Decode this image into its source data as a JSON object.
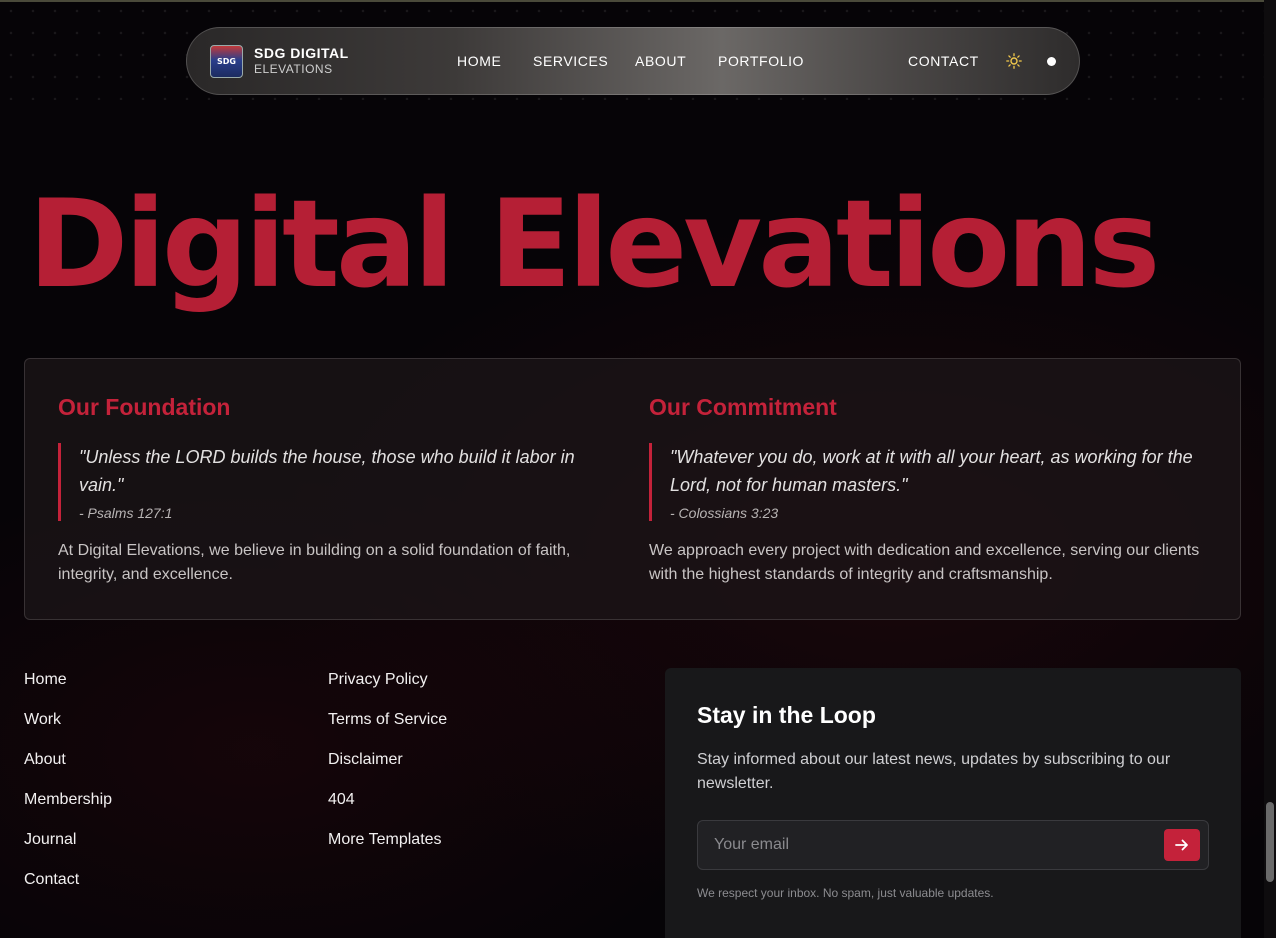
{
  "nav": {
    "brand_name": "SDG DIGITAL",
    "brand_sub": "ELEVATIONS",
    "logo_text": "SDG",
    "links": [
      "HOME",
      "SERVICES",
      "ABOUT",
      "PORTFOLIO",
      "CONTACT"
    ],
    "theme_icon": "sun-icon"
  },
  "hero": {
    "title": "Digital Elevations"
  },
  "foundation": {
    "heading": "Our Foundation",
    "quote": "\"Unless the LORD builds the house, those who build it labor in vain.\"",
    "citation": "- Psalms 127:1",
    "description": "At Digital Elevations, we believe in building on a solid foundation of faith, integrity, and excellence."
  },
  "commitment": {
    "heading": "Our Commitment",
    "quote": "\"Whatever you do, work at it with all your heart, as working for the Lord, not for human masters.\"",
    "citation": "- Colossians 3:23",
    "description": "We approach every project with dedication and excellence, serving our clients with the highest standards of integrity and craftsmanship."
  },
  "footer": {
    "col1": [
      "Home",
      "Work",
      "About",
      "Membership",
      "Journal",
      "Contact"
    ],
    "col2": [
      "Privacy Policy",
      "Terms of Service",
      "Disclaimer",
      "404",
      "More Templates"
    ]
  },
  "newsletter": {
    "title": "Stay in the Loop",
    "text": "Stay informed about our latest news, updates by subscribing to our newsletter.",
    "placeholder": "Your email",
    "value": "",
    "note": "We respect your inbox. No spam, just valuable updates."
  },
  "colors": {
    "accent": "#c4223a",
    "hero": "#b51f35"
  }
}
